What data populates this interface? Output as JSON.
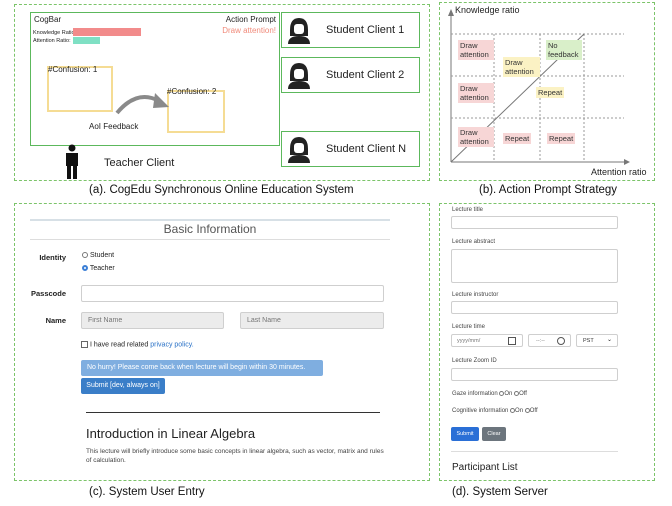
{
  "panel_a": {
    "caption": "(a). CogEdu Synchronous Online Education System",
    "cogbar_title": "CogBar",
    "knowledge_ratio_label": "Knowledge Ratio:",
    "attention_ratio_label": "Attention Ratio:",
    "knowledge_ratio": 0.8,
    "attention_ratio": 0.27,
    "action_prompt_title": "Action Prompt",
    "action_prompt_text": "Draw attention!",
    "confusion_1": "#Confusion: 1",
    "confusion_2": "#Confusion: 2",
    "aoi_feedback": "AoI Feedback",
    "teacher_client": "Teacher Client",
    "students": [
      "Student Client 1",
      "Student Client 2",
      "Student Client N"
    ],
    "colors": {
      "knowledge": "#f28b8b",
      "attention": "#7fe0c4",
      "prompt": "#f08a7a",
      "box_green": "#5cb85c",
      "confusion_box": "#f5dc94"
    }
  },
  "panel_b": {
    "caption": "(b). Action Prompt Strategy",
    "y_axis_label": "Knowledge ratio",
    "x_axis_label": "Attention ratio",
    "cells": [
      {
        "text": "Draw attention",
        "color": "red"
      },
      {
        "text": "Draw attention",
        "color": "yellow"
      },
      {
        "text": "No feedback",
        "color": "green"
      },
      {
        "text": "Draw attention",
        "color": "red"
      },
      {
        "text": "Repeat",
        "color": "yellow"
      },
      {
        "text": "Draw attention",
        "color": "red"
      },
      {
        "text": "Repeat",
        "color": "red"
      },
      {
        "text": "Repeat",
        "color": "red"
      }
    ]
  },
  "panel_c": {
    "caption": "(c). System User Entry",
    "header": "Basic Information",
    "identity_label": "Identity",
    "identity_options": [
      "Student",
      "Teacher"
    ],
    "identity_selected": "Teacher",
    "passcode_label": "Passcode",
    "passcode_value": "",
    "name_label": "Name",
    "first_name_placeholder": "First Name",
    "last_name_placeholder": "Last Name",
    "checkbox_text": "I have read related",
    "privacy_link": "privacy policy.",
    "notice_text": "No hurry! Please come back when lecture will begin within 30 minutes.",
    "submit_label": "Submit [dev, always on]",
    "lecture_title": "Introduction in Linear Algebra",
    "lecture_desc": "This lecture will briefly introduce some basic concepts in linear algebra, such as vector, matrix and rules of calculation."
  },
  "panel_d": {
    "caption": "(d). System Server",
    "lecture_title_label": "Lecture title",
    "lecture_abstract_label": "Lecture abstract",
    "lecture_instructor_label": "Lecture instructor",
    "lecture_time_label": "Lecture time",
    "date_placeholder": "yyyy/mm/",
    "time_placeholder": "--:--",
    "timezone": "PST",
    "zoom_label": "Lecture Zoom ID",
    "gaze_label": "Gaze information",
    "cognitive_label": "Cognitive information",
    "on_label": "On",
    "off_label": "Off",
    "submit_label": "Submit",
    "clear_label": "Clear",
    "participant_list": "Participant List"
  }
}
